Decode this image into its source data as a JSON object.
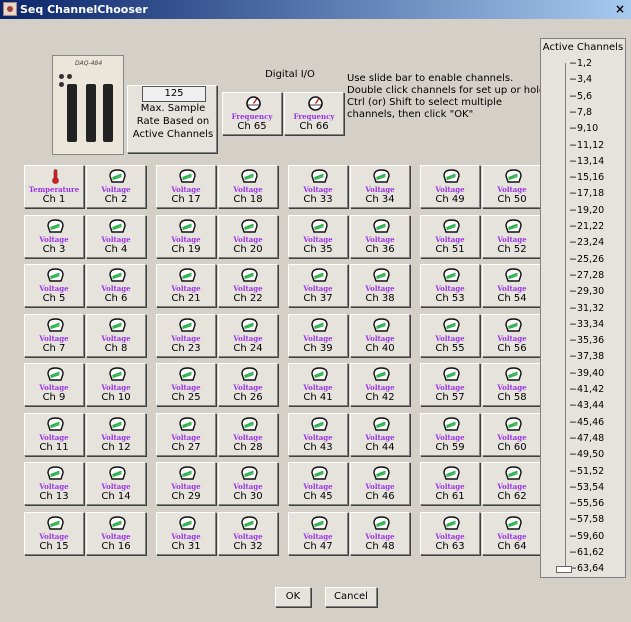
{
  "window": {
    "title": "Seq ChannelChooser",
    "close_label": "×"
  },
  "device": {
    "model": "DAQ-484"
  },
  "rate": {
    "value": "125",
    "label": "Max. Sample Rate Based on Active Channels"
  },
  "digital_io": {
    "title": "Digital I/O",
    "channels": [
      {
        "type": "Frequency",
        "name": "Ch 65"
      },
      {
        "type": "Frequency",
        "name": "Ch 66"
      }
    ]
  },
  "instructions": "Use slide bar to enable channels.\nDouble click channels for set up or hold Ctrl (or) Shift to select multiple channels, then click \"OK\"",
  "channels": [
    {
      "type": "Temperature",
      "name": "Ch 1"
    },
    {
      "type": "Voltage",
      "name": "Ch 2"
    },
    {
      "type": "Voltage",
      "name": "Ch 3"
    },
    {
      "type": "Voltage",
      "name": "Ch 4"
    },
    {
      "type": "Voltage",
      "name": "Ch 5"
    },
    {
      "type": "Voltage",
      "name": "Ch 6"
    },
    {
      "type": "Voltage",
      "name": "Ch 7"
    },
    {
      "type": "Voltage",
      "name": "Ch 8"
    },
    {
      "type": "Voltage",
      "name": "Ch 9"
    },
    {
      "type": "Voltage",
      "name": "Ch 10"
    },
    {
      "type": "Voltage",
      "name": "Ch 11"
    },
    {
      "type": "Voltage",
      "name": "Ch 12"
    },
    {
      "type": "Voltage",
      "name": "Ch 13"
    },
    {
      "type": "Voltage",
      "name": "Ch 14"
    },
    {
      "type": "Voltage",
      "name": "Ch 15"
    },
    {
      "type": "Voltage",
      "name": "Ch 16"
    },
    {
      "type": "Voltage",
      "name": "Ch 17"
    },
    {
      "type": "Voltage",
      "name": "Ch 18"
    },
    {
      "type": "Voltage",
      "name": "Ch 19"
    },
    {
      "type": "Voltage",
      "name": "Ch 20"
    },
    {
      "type": "Voltage",
      "name": "Ch 21"
    },
    {
      "type": "Voltage",
      "name": "Ch 22"
    },
    {
      "type": "Voltage",
      "name": "Ch 23"
    },
    {
      "type": "Voltage",
      "name": "Ch 24"
    },
    {
      "type": "Voltage",
      "name": "Ch 25"
    },
    {
      "type": "Voltage",
      "name": "Ch 26"
    },
    {
      "type": "Voltage",
      "name": "Ch 27"
    },
    {
      "type": "Voltage",
      "name": "Ch 28"
    },
    {
      "type": "Voltage",
      "name": "Ch 29"
    },
    {
      "type": "Voltage",
      "name": "Ch 30"
    },
    {
      "type": "Voltage",
      "name": "Ch 31"
    },
    {
      "type": "Voltage",
      "name": "Ch 32"
    },
    {
      "type": "Voltage",
      "name": "Ch 33"
    },
    {
      "type": "Voltage",
      "name": "Ch 34"
    },
    {
      "type": "Voltage",
      "name": "Ch 35"
    },
    {
      "type": "Voltage",
      "name": "Ch 36"
    },
    {
      "type": "Voltage",
      "name": "Ch 37"
    },
    {
      "type": "Voltage",
      "name": "Ch 38"
    },
    {
      "type": "Voltage",
      "name": "Ch 39"
    },
    {
      "type": "Voltage",
      "name": "Ch 40"
    },
    {
      "type": "Voltage",
      "name": "Ch 41"
    },
    {
      "type": "Voltage",
      "name": "Ch 42"
    },
    {
      "type": "Voltage",
      "name": "Ch 43"
    },
    {
      "type": "Voltage",
      "name": "Ch 44"
    },
    {
      "type": "Voltage",
      "name": "Ch 45"
    },
    {
      "type": "Voltage",
      "name": "Ch 46"
    },
    {
      "type": "Voltage",
      "name": "Ch 47"
    },
    {
      "type": "Voltage",
      "name": "Ch 48"
    },
    {
      "type": "Voltage",
      "name": "Ch 49"
    },
    {
      "type": "Voltage",
      "name": "Ch 50"
    },
    {
      "type": "Voltage",
      "name": "Ch 51"
    },
    {
      "type": "Voltage",
      "name": "Ch 52"
    },
    {
      "type": "Voltage",
      "name": "Ch 53"
    },
    {
      "type": "Voltage",
      "name": "Ch 54"
    },
    {
      "type": "Voltage",
      "name": "Ch 55"
    },
    {
      "type": "Voltage",
      "name": "Ch 56"
    },
    {
      "type": "Voltage",
      "name": "Ch 57"
    },
    {
      "type": "Voltage",
      "name": "Ch 58"
    },
    {
      "type": "Voltage",
      "name": "Ch 59"
    },
    {
      "type": "Voltage",
      "name": "Ch 60"
    },
    {
      "type": "Voltage",
      "name": "Ch 61"
    },
    {
      "type": "Voltage",
      "name": "Ch 62"
    },
    {
      "type": "Voltage",
      "name": "Ch 63"
    },
    {
      "type": "Voltage",
      "name": "Ch 64"
    }
  ],
  "active_channels": {
    "title": "Active Channels",
    "labels": [
      "1,2",
      "3,4",
      "5,6",
      "7,8",
      "9,10",
      "11,12",
      "13,14",
      "15,16",
      "17,18",
      "19,20",
      "21,22",
      "23,24",
      "25,26",
      "27,28",
      "29,30",
      "31,32",
      "33,34",
      "35,36",
      "37,38",
      "39,40",
      "41,42",
      "43,44",
      "45,46",
      "47,48",
      "49,50",
      "51,52",
      "53,54",
      "55,56",
      "57,58",
      "59,60",
      "61,62",
      "63,64"
    ],
    "selected": "63,64"
  },
  "buttons": {
    "ok": "OK",
    "cancel": "Cancel"
  },
  "colors": {
    "type_text": "#9b32e6",
    "meter_green": "#2bb14a",
    "thermo_red": "#d02020"
  }
}
